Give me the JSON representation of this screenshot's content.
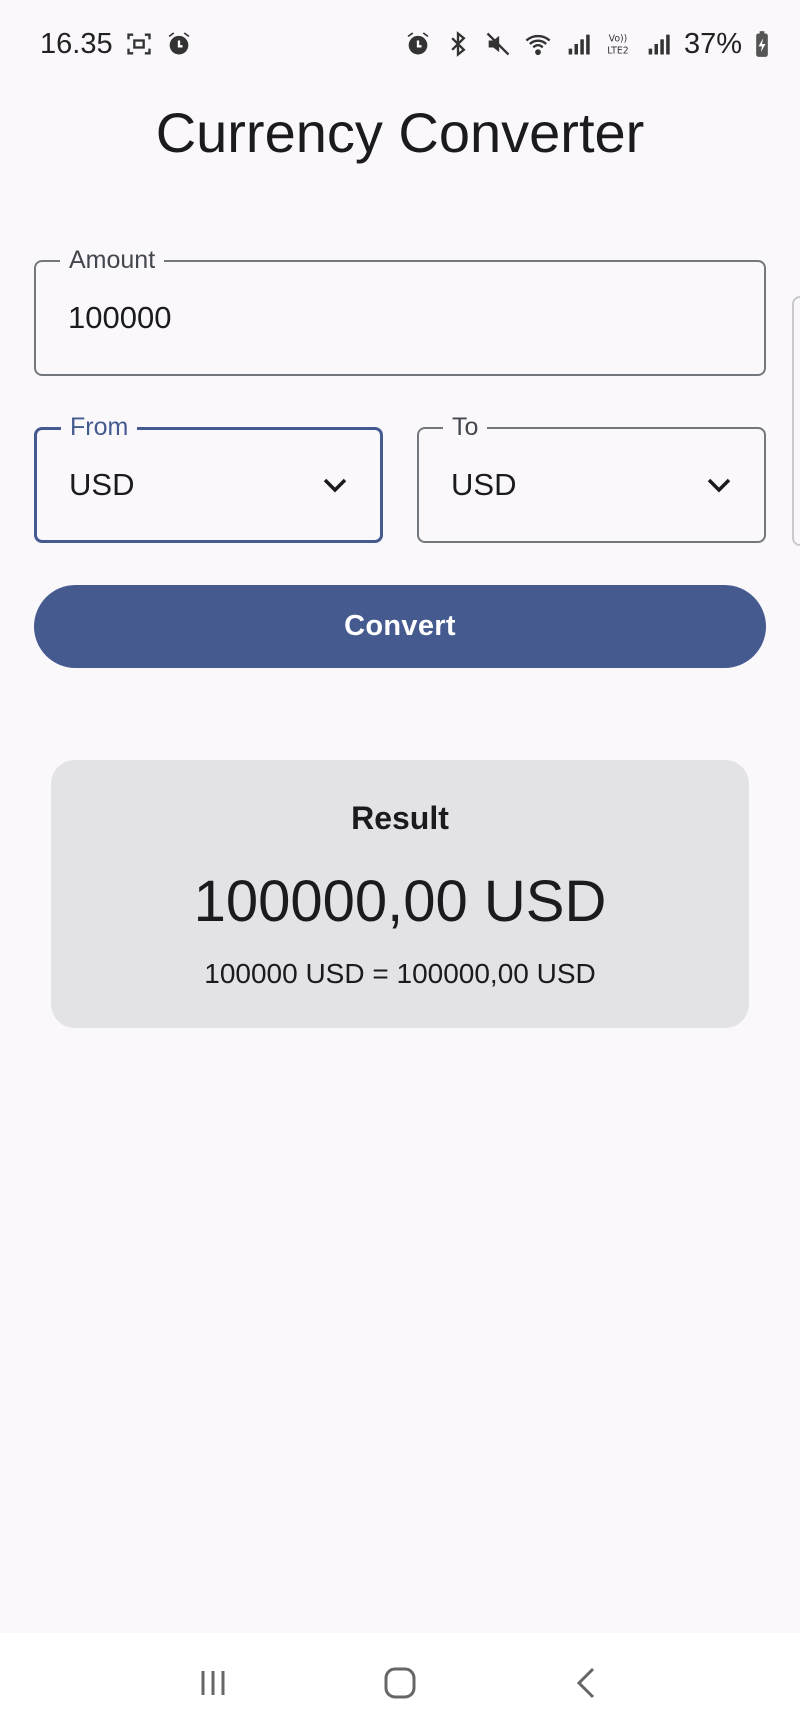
{
  "status_bar": {
    "time": "16.35",
    "battery": "37%",
    "left_icons": [
      "screenshot-icon",
      "alarm-icon"
    ],
    "right_icons": [
      "alarm-icon",
      "bluetooth-icon",
      "mute-icon",
      "wifi-icon",
      "signal-icon",
      "volte-icon",
      "signal-icon"
    ]
  },
  "title": "Currency Converter",
  "amount": {
    "label": "Amount",
    "value": "100000"
  },
  "from": {
    "label": "From",
    "value": "USD"
  },
  "to": {
    "label": "To",
    "value": "USD"
  },
  "convert_label": "Convert",
  "result": {
    "title": "Result",
    "value": "100000,00 USD",
    "detail": "100000 USD = 100000,00 USD"
  },
  "nav": [
    "recent-apps-icon",
    "home-icon",
    "back-icon"
  ],
  "colors": {
    "accent": "#455a8f",
    "background": "#fbf8fc",
    "card": "#e3e2e6"
  }
}
